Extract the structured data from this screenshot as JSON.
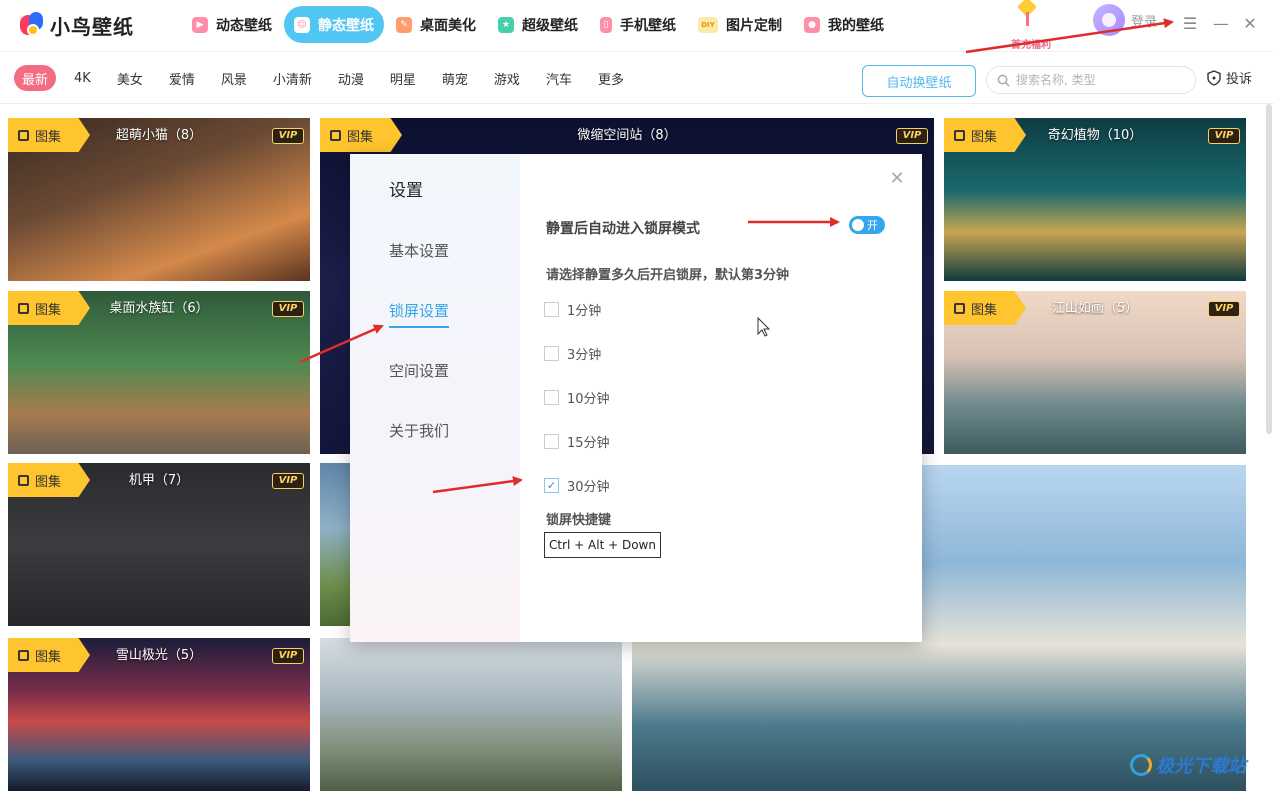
{
  "app": {
    "name": "小鸟壁纸"
  },
  "topnav": [
    {
      "label": "动态壁纸",
      "icon": "play-icon",
      "color": "#ff7b9a"
    },
    {
      "label": "静态壁纸",
      "icon": "image-icon",
      "color": "#ffffff",
      "active": true
    },
    {
      "label": "桌面美化",
      "icon": "brush-icon",
      "color": "#ff8a5c"
    },
    {
      "label": "超级壁纸",
      "icon": "star-icon",
      "color": "#38c9a6"
    },
    {
      "label": "手机壁纸",
      "icon": "phone-icon",
      "color": "#ff7b9a"
    },
    {
      "label": "图片定制",
      "icon": "diy-icon",
      "color": "#ffc947",
      "badge": "DIY"
    },
    {
      "label": "我的壁纸",
      "icon": "user-icon",
      "color": "#ff7b9a"
    }
  ],
  "header": {
    "login": "登录",
    "promo": "首充福利"
  },
  "categories": [
    "最新",
    "4K",
    "美女",
    "爱情",
    "风景",
    "小清新",
    "动漫",
    "明星",
    "萌宠",
    "游戏",
    "汽车",
    "更多"
  ],
  "toolbar": {
    "auto_change": "自动换壁纸",
    "search_placeholder": "搜索名称, 类型",
    "report": "投诉"
  },
  "cards": [
    {
      "title": "超萌小猫（8）",
      "tag": "图集",
      "vip": "VIP",
      "bg": "linear-gradient(160deg,#3a2a22 0%,#6b4a34 40%,#d4894a 75%,#5a3320 100%)"
    },
    {
      "title": "微缩空间站（8）",
      "tag": "图集",
      "vip": "VIP",
      "bg": "linear-gradient(180deg,#0c1030 0%,#1b1f4a 50%,#12163a 100%)"
    },
    {
      "title": "奇幻植物（10）",
      "tag": "图集",
      "vip": "VIP",
      "bg": "linear-gradient(180deg,#0d3c43 0%,#1a6a6c 45%,#c8a552 70%,#0f3a3f 100%)"
    },
    {
      "title": "桌面水族缸（6）",
      "tag": "图集",
      "vip": "VIP",
      "bg": "linear-gradient(180deg,#2f5a3a 0%,#4e8a52 45%,#a77b4e 75%,#6b6154 100%)"
    },
    {
      "title": "江山如画（5）",
      "tag": "图集",
      "vip": "VIP",
      "bg": "linear-gradient(180deg,#f2d9c6 0%,#d8c2b5 40%,#6f8a8c 70%,#3f5a5e 100%)"
    },
    {
      "title": "机甲（7）",
      "tag": "图集",
      "vip": "VIP",
      "bg": "linear-gradient(180deg,#2a2b2e 0%,#3a3c40 50%,#26272a 100%)"
    },
    {
      "title": "",
      "tag": "",
      "vip": "",
      "bg": "linear-gradient(180deg,#5f86a8 0%,#8fb1c7 40%,#6f8d4a 75%,#4c6a34 100%)"
    },
    {
      "title": "",
      "tag": "",
      "vip": "",
      "bg": "linear-gradient(180deg,#b9d6ef 0%,#8eb7d8 30%,#e6e2d8 55%,#4c7a8c 80%,#2d4f5e 100%)"
    },
    {
      "title": "雪山极光（5）",
      "tag": "图集",
      "vip": "VIP",
      "bg": "linear-gradient(180deg,#1a1d3a 0%,#7a2e4a 35%,#c74a4a 55%,#3c5a7a 80%,#151a2a 100%)"
    },
    {
      "title": "",
      "tag": "",
      "vip": "",
      "bg": "linear-gradient(180deg,#d6dde2 0%,#a8b7bf 40%,#7c8b75 75%,#4f5e47 100%)"
    }
  ],
  "modal": {
    "title": "设置",
    "menu": [
      "基本设置",
      "锁屏设置",
      "空间设置",
      "关于我们"
    ],
    "active_menu": "锁屏设置",
    "auto_lock_label": "静置后自动进入锁屏模式",
    "toggle_text": "开",
    "idle_prompt": "请选择静置多久后开启锁屏，默认第3分钟",
    "options": [
      {
        "label": "1分钟",
        "checked": false
      },
      {
        "label": "3分钟",
        "checked": false
      },
      {
        "label": "10分钟",
        "checked": false
      },
      {
        "label": "15分钟",
        "checked": false
      },
      {
        "label": "30分钟",
        "checked": true
      }
    ],
    "shortcut_title": "锁屏快捷键",
    "shortcut": "Ctrl + Alt + Down"
  },
  "watermark": "极光下载站"
}
